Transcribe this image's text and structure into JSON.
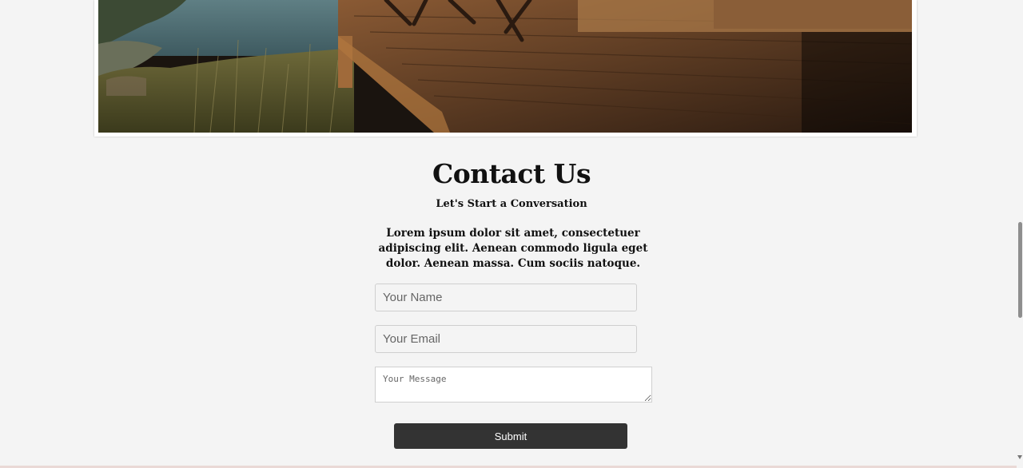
{
  "hero": {
    "image_description": "hero-photo"
  },
  "contact": {
    "title": "Contact Us",
    "subtitle": "Let's Start a Conversation",
    "description": "Lorem ipsum dolor sit amet, consectetuer adipiscing elit. Aenean commodo ligula eget dolor. Aenean massa. Cum sociis natoque."
  },
  "form": {
    "name_placeholder": "Your Name",
    "email_placeholder": "Your Email",
    "message_placeholder": "Your Message",
    "submit_label": "Submit"
  },
  "colors": {
    "background": "#f4f4f4",
    "button": "#333333",
    "button_text": "#ffffff",
    "text": "#111111"
  }
}
